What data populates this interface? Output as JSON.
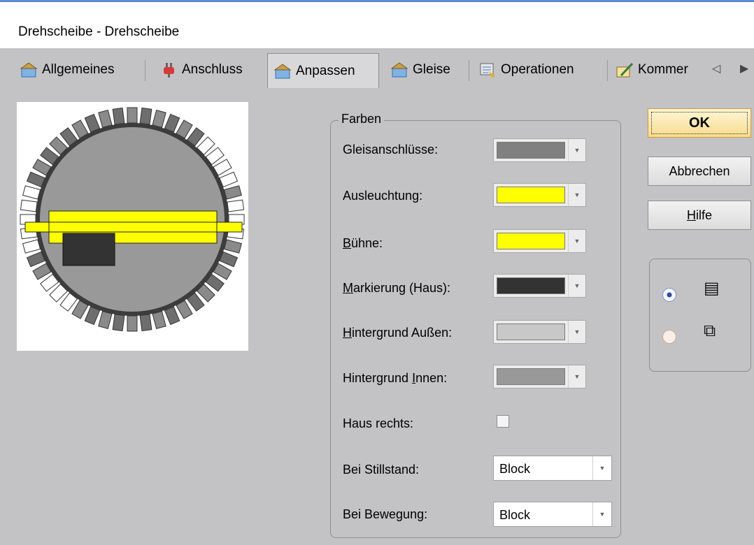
{
  "window": {
    "title": "Drehscheibe - Drehscheibe"
  },
  "tabs": [
    {
      "label": "Allgemeines",
      "icon": "settings-icon"
    },
    {
      "label": "Anschluss",
      "icon": "plug-icon"
    },
    {
      "label": "Anpassen",
      "icon": "settings-icon",
      "active": true
    },
    {
      "label": "Gleise",
      "icon": "settings-icon"
    },
    {
      "label": "Operationen",
      "icon": "operations-icon"
    },
    {
      "label": "Kommer",
      "icon": "comment-icon"
    }
  ],
  "colors_group": {
    "legend": "Farben",
    "rows": [
      {
        "label": "Gleisanschlüsse:",
        "color": "#808080"
      },
      {
        "label": "Ausleuchtung:",
        "color": "#ffff00"
      },
      {
        "label_u": "B",
        "label_rest": "ühne:",
        "color": "#ffff00"
      },
      {
        "label_u": "M",
        "label_rest": "arkierung (Haus):",
        "color": "#333333"
      },
      {
        "label_u": "H",
        "label_rest": "intergrund Außen:",
        "color": "#c8c8c8"
      },
      {
        "label_pre": "Hintergrund ",
        "label_u": "I",
        "label_rest": "nnen:",
        "color": "#999999"
      }
    ],
    "haus_rechts": {
      "label": "Haus rechts:",
      "checked": false
    },
    "stillstand": {
      "label": "Bei Stillstand:",
      "value": "Block"
    },
    "bewegung": {
      "label": "Bei Bewegung:",
      "value": "Block"
    }
  },
  "buttons": {
    "ok": "OK",
    "cancel": "Abbrechen",
    "help_u": "H",
    "help_rest": "ilfe"
  },
  "view_options": [
    {
      "icon": "list-view-icon",
      "glyph": "▤",
      "selected": true
    },
    {
      "icon": "cascade-view-icon",
      "glyph": "⧉",
      "selected": false
    }
  ]
}
